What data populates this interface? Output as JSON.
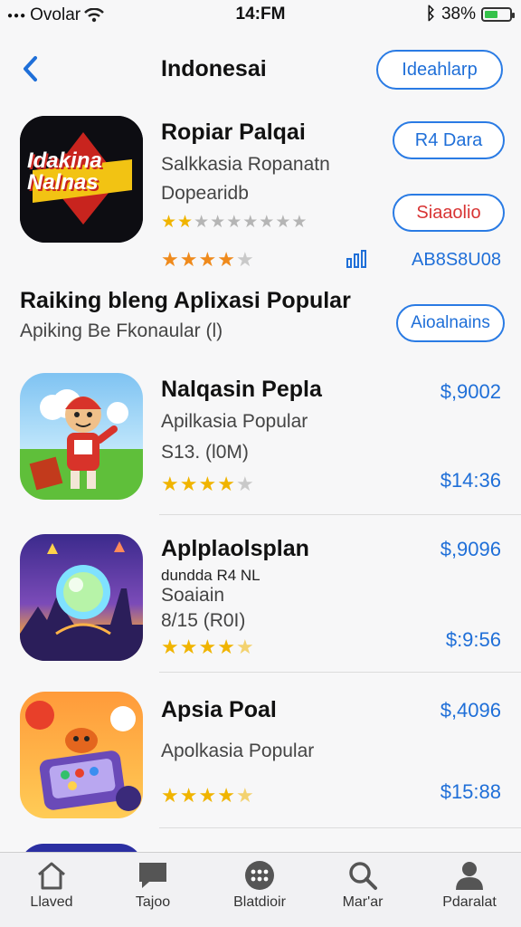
{
  "status": {
    "carrier": "Ovolar",
    "time": "14:FM",
    "battery": "38%",
    "battery_level": 0.38
  },
  "nav": {
    "title": "Indonesai",
    "action": "Ideahlarp"
  },
  "featured": {
    "title": "Ropiar Palqai",
    "subtitle": "Salkkasia Ropanatn",
    "line3": "Dopearidb",
    "icon_text": "Idakina Nalnas",
    "rating_small": 2,
    "rating": 4,
    "btn_primary": "R4 Dara",
    "btn_secondary": "Siaaolio",
    "meta": "AB8S8U08"
  },
  "section": {
    "title": "Raiking bleng Aplixasi Popular",
    "subtitle": "Apiking Be Fkonaular (l)",
    "button": "Aioalnains"
  },
  "apps": [
    {
      "title": "Nalqasin Pepla",
      "line1": "Apilkasia Popular",
      "line2": "S13. (l0M)",
      "line3": "",
      "rating": 4,
      "price_top": "$,9002",
      "price_bottom": "$14:36"
    },
    {
      "title": "Aplplaolsplan",
      "line1": "dundda R4 NL",
      "line2": "Soaiain",
      "line3": "8/15 (R0I)",
      "rating": 4.5,
      "price_top": "$,9096",
      "price_bottom": "$:9:56"
    },
    {
      "title": "Apsia Poal",
      "line1": "Apolkasia Popular",
      "line2": "",
      "line3": "",
      "rating": 4.5,
      "price_top": "$,4096",
      "price_bottom": "$15:88"
    }
  ],
  "tabs": [
    {
      "label": "Llaved",
      "icon": "home-icon"
    },
    {
      "label": "Tajoo",
      "icon": "chat-icon"
    },
    {
      "label": "Blatdioir",
      "icon": "grid-icon"
    },
    {
      "label": "Mar'ar",
      "icon": "search-icon"
    },
    {
      "label": "Pdaralat",
      "icon": "person-icon"
    }
  ],
  "colors": {
    "accent": "#1f6fd8",
    "star": "#f0b400",
    "red": "#d83434"
  }
}
